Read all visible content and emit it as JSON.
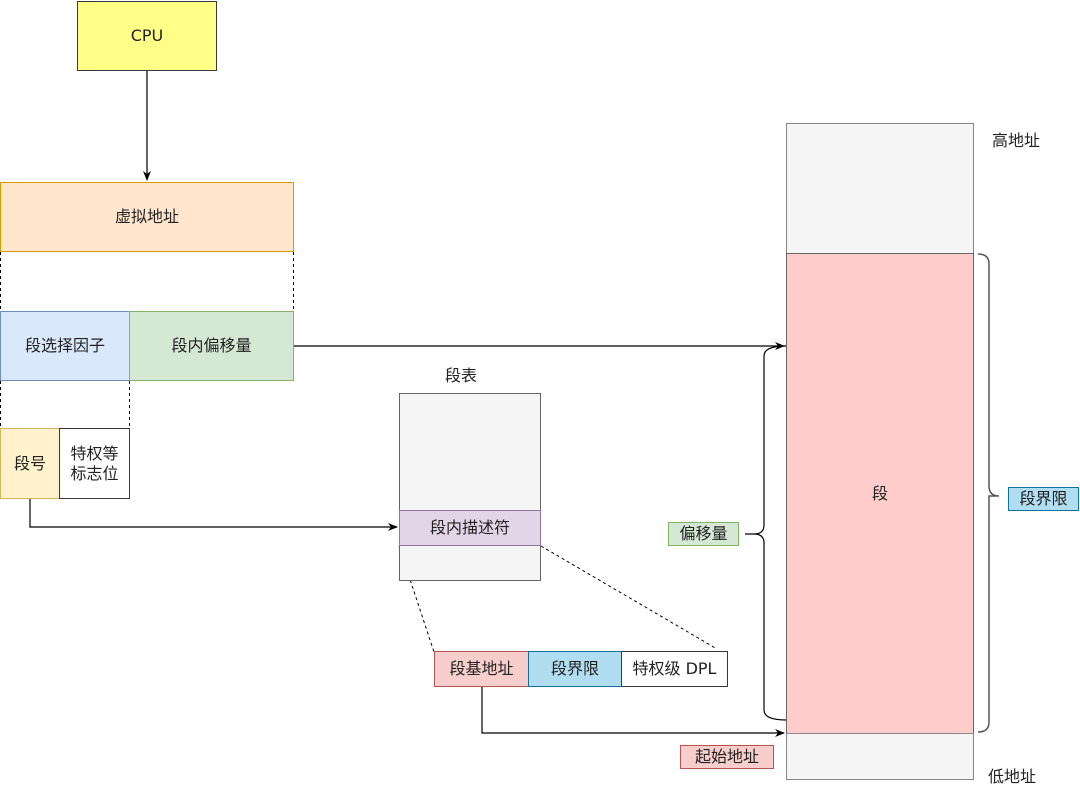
{
  "diagram": {
    "cpu": {
      "label": "CPU",
      "fill": "#ffff88",
      "stroke": "#36393d"
    },
    "virtual_address": {
      "label": "虚拟地址",
      "fill": "#ffe6cc",
      "stroke": "#d79b00"
    },
    "segment_selector": {
      "label": "段选择因子",
      "fill": "#dae8fc",
      "stroke": "#6c8ebf"
    },
    "segment_offset": {
      "label": "段内偏移量",
      "fill": "#d5e8d4",
      "stroke": "#82b366"
    },
    "segment_number": {
      "label": "段号",
      "fill": "#fff2cc",
      "stroke": "#d6b656"
    },
    "privilege_flags": {
      "label_line1": "特权等",
      "label_line2": "标志位"
    },
    "segment_table": {
      "title": "段表",
      "descriptor": {
        "label": "段内描述符",
        "fill": "#e1d5e7",
        "stroke": "#9673a6"
      }
    },
    "descriptor_fields": {
      "base_address": {
        "label": "段基地址",
        "fill": "#f8cecc",
        "stroke": "#b85450"
      },
      "limit": {
        "label": "段界限",
        "fill": "#b1ddf0",
        "stroke": "#10739e"
      },
      "dpl": {
        "label": "特权级 DPL"
      }
    },
    "memory": {
      "high_address": "高地址",
      "low_address": "低地址",
      "segment": {
        "label": "段",
        "fill": "#ffcccc"
      },
      "empty_fill": "#f5f5f5"
    },
    "annotations": {
      "offset": "偏移量",
      "segment_limit": "段界限",
      "start_address": "起始地址"
    }
  }
}
